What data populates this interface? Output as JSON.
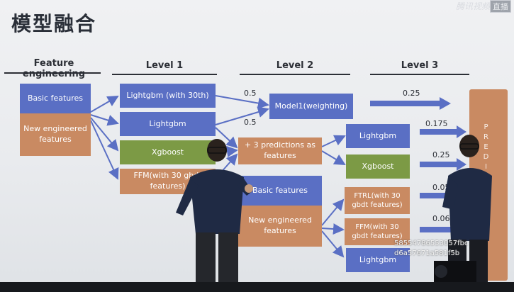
{
  "slide": {
    "title": "模型融合",
    "headers": [
      "Feature engineering",
      "Level 1",
      "Level 2",
      "Level 3"
    ],
    "feature_boxes": [
      "Basic features",
      "New engineered features"
    ],
    "level1_boxes": [
      "Lightgbm (with 30th)",
      "Lightgbm",
      "Xgboost",
      "FFM(with 30 gbdt features)"
    ],
    "level2_boxes": [
      "Model1(weighting)",
      "+ 3 predictions as features",
      "Basic features",
      "New engineered features"
    ],
    "level2b_boxes": [
      "Lightgbm",
      "Xgboost",
      "FTRL(with 30 gbdt features)",
      "FFM(with 30 gbdt features)",
      "Lightgbm"
    ],
    "weights": [
      "0.5",
      "0.5",
      "0.25",
      "0.175",
      "0.25",
      "0.05",
      "0.06"
    ],
    "predictions_label": "PREDICTIONS"
  },
  "overlay": {
    "watermark": "腾讯视频",
    "watermark_box": "直播",
    "hash_line1": "58554786553057fbc",
    "hash_line2": "d6a57671a581f5b"
  },
  "colors": {
    "blue": "#5a6fc4",
    "orange": "#c98a62",
    "green": "#7c9a45",
    "dark": "#2c2f36"
  }
}
